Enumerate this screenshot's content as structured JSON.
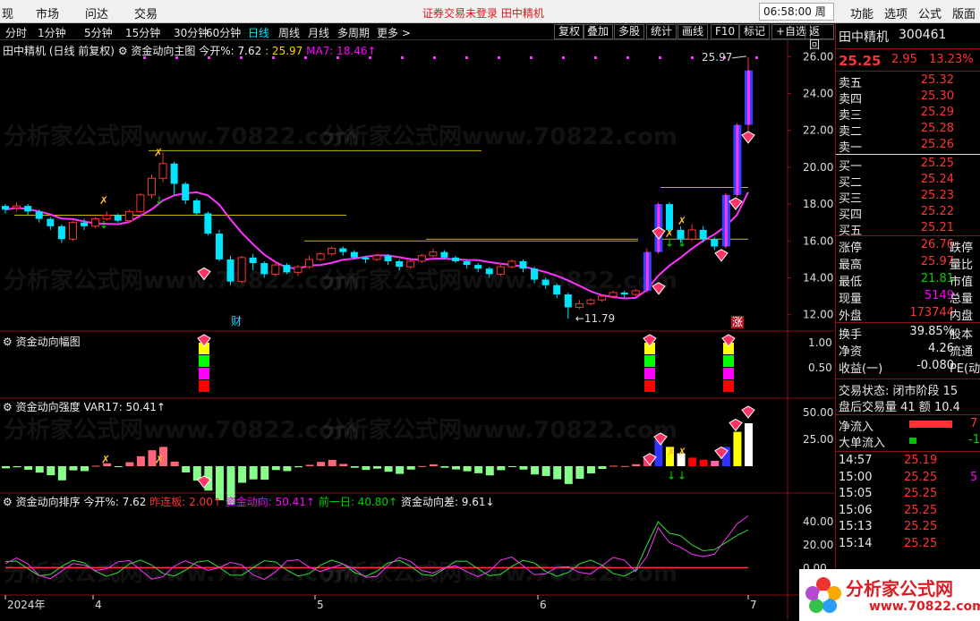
{
  "menu": {
    "items": [
      "现",
      "市场",
      "问达",
      "交易"
    ],
    "warning": "证券交易未登录  田中精机",
    "clock": "06:58:00 周二",
    "right_items": [
      "功能",
      "选项",
      "公式",
      "版面"
    ]
  },
  "toolbar": {
    "periods": [
      "分时",
      "1分钟",
      "5分钟",
      "15分钟",
      "30分钟",
      "60分钟",
      "日线",
      "周线",
      "月线",
      "多周期",
      "更多 >"
    ],
    "active_period": "日线",
    "buttons": [
      "复权",
      "叠加",
      "多股",
      "统计",
      "画线",
      "F10",
      "标记",
      "+自选",
      "返回"
    ]
  },
  "main_panel": {
    "title": "田中精机 (日线 前复权)",
    "indicator": "资金动向主图",
    "open_pct": "今开%: 7.62",
    "value1": ": 25.97",
    "ma_label": "MA7: 18.46↑",
    "high_label": "25.97",
    "low_label": "11.79",
    "tag_cai": "财",
    "tag_zhang": "涨",
    "y_ticks": [
      "26.00",
      "24.00",
      "22.00",
      "20.00",
      "18.00",
      "16.00",
      "14.00",
      "12.00"
    ]
  },
  "panel2": {
    "title": "资金动向幅图",
    "y_ticks": [
      "1.00",
      "0.50"
    ]
  },
  "panel3": {
    "title": "资金动向强度",
    "var": "VAR17: 50.41↑",
    "y_ticks": [
      "50.00",
      "25.00"
    ]
  },
  "panel4": {
    "title": "资金动向排序",
    "open_pct": "今开%: 7.62",
    "prev_limit": "昨连板: 2.00↑",
    "flow": "资金动向: 50.41↑",
    "prev_day": "前一日: 40.80↑",
    "diff": "资金动向差: 9.61↓",
    "y_ticks": [
      "40.00",
      "20.00",
      "0.00"
    ]
  },
  "x_axis": [
    "2024年",
    "4",
    "5",
    "6",
    "7"
  ],
  "watermark": "分析家公式网www.70822.com",
  "quote": {
    "name": "田中精机",
    "code": "300461",
    "price": "25.25",
    "change": "2.95",
    "change_pct": "13.23%",
    "asks": [
      {
        "label": "卖五",
        "price": "25.32"
      },
      {
        "label": "卖四",
        "price": "25.30"
      },
      {
        "label": "卖三",
        "price": "25.29"
      },
      {
        "label": "卖二",
        "price": "25.28"
      },
      {
        "label": "卖一",
        "price": "25.26"
      }
    ],
    "bids": [
      {
        "label": "买一",
        "price": "25.25"
      },
      {
        "label": "买二",
        "price": "25.24"
      },
      {
        "label": "买三",
        "price": "25.23"
      },
      {
        "label": "买四",
        "price": "25.22"
      },
      {
        "label": "买五",
        "price": "25.21"
      }
    ],
    "stats": [
      {
        "label": "涨停",
        "value": "26.76",
        "color": "#ff3333",
        "right": "跌停"
      },
      {
        "label": "最高",
        "value": "25.97",
        "color": "#ff3333",
        "right": "量比"
      },
      {
        "label": "最低",
        "value": "21.81",
        "color": "#00d000",
        "right": "市值"
      },
      {
        "label": "现量",
        "value": "5149",
        "color": "#ff00ff",
        "right": "总量"
      },
      {
        "label": "外盘",
        "value": "173744",
        "color": "#ff3333",
        "right": "内盘"
      }
    ],
    "stats2": [
      {
        "label": "换手",
        "value": "39.85%",
        "color": "#eeeeee",
        "right": "股本"
      },
      {
        "label": "净资",
        "value": "4.26",
        "color": "#eeeeee",
        "right": "流通"
      },
      {
        "label": "收益(一)",
        "value": "-0.080",
        "color": "#eeeeee",
        "right": "PE(动"
      }
    ],
    "trade_status": "交易状态: 闭市阶段 15",
    "after_hours": "盘后交易量 41 额 10.4",
    "net_inflow": "净流入",
    "big_inflow": "大单流入",
    "net_inflow_right": "7",
    "big_inflow_right": "-1",
    "ticks": [
      {
        "time": "14:57",
        "price": "25.19"
      },
      {
        "time": "15:00",
        "price": "25.25",
        "right": "5"
      },
      {
        "time": "15:05",
        "price": "25.25"
      },
      {
        "time": "15:06",
        "price": "25.25"
      },
      {
        "time": "15:13",
        "price": "25.25"
      },
      {
        "time": "15:14",
        "price": "25.25"
      }
    ]
  },
  "logo": {
    "title": "分析家公式网",
    "url": "www.70822.com"
  },
  "colors": {
    "up": "#ff3333",
    "down": "#00e5ff",
    "ma": "#ff33ff",
    "bg": "#000000",
    "grid": "#8a1111"
  },
  "chart_data": {
    "type": "candlestick",
    "x": [
      "2024-03",
      "2024-04",
      "2024-05",
      "2024-06",
      "2024-07"
    ],
    "ylim": [
      11.5,
      26.5
    ],
    "candles": [
      [
        17.9,
        17.7,
        18.0,
        17.5
      ],
      [
        17.8,
        17.9,
        18.1,
        17.6
      ],
      [
        17.9,
        17.6,
        18.0,
        17.4
      ],
      [
        17.6,
        17.2,
        17.7,
        17.0
      ],
      [
        17.2,
        16.8,
        17.3,
        16.6
      ],
      [
        16.8,
        16.1,
        16.9,
        15.9
      ],
      [
        16.1,
        17.0,
        17.1,
        16.0
      ],
      [
        17.0,
        16.8,
        17.2,
        16.6
      ],
      [
        16.8,
        17.2,
        17.3,
        16.7
      ],
      [
        17.2,
        17.4,
        17.6,
        17.1
      ],
      [
        17.4,
        17.1,
        17.5,
        17.0
      ],
      [
        17.1,
        17.6,
        17.7,
        17.0
      ],
      [
        17.6,
        18.5,
        18.6,
        17.5
      ],
      [
        18.5,
        19.4,
        19.6,
        18.3
      ],
      [
        19.4,
        20.2,
        20.8,
        19.2
      ],
      [
        20.2,
        19.1,
        20.3,
        18.5
      ],
      [
        19.1,
        18.2,
        19.2,
        18.0
      ],
      [
        18.2,
        17.5,
        18.3,
        17.4
      ],
      [
        17.5,
        16.4,
        17.6,
        16.3
      ],
      [
        16.4,
        15.0,
        16.6,
        14.9
      ],
      [
        15.0,
        13.8,
        15.2,
        13.6
      ],
      [
        13.8,
        15.1,
        15.2,
        13.7
      ],
      [
        15.1,
        14.8,
        15.3,
        14.4
      ],
      [
        14.8,
        14.2,
        14.9,
        14.0
      ],
      [
        14.2,
        14.7,
        14.9,
        14.1
      ],
      [
        14.7,
        14.3,
        14.8,
        14.2
      ],
      [
        14.3,
        14.6,
        14.7,
        14.1
      ],
      [
        14.6,
        15.0,
        15.2,
        14.5
      ],
      [
        15.0,
        15.3,
        15.4,
        14.9
      ],
      [
        15.3,
        15.6,
        15.7,
        15.2
      ],
      [
        15.6,
        15.4,
        15.7,
        15.2
      ],
      [
        15.4,
        15.1,
        15.5,
        15.0
      ],
      [
        15.1,
        15.0,
        15.2,
        14.8
      ],
      [
        15.0,
        15.2,
        15.3,
        14.9
      ],
      [
        15.2,
        14.9,
        15.3,
        14.7
      ],
      [
        14.9,
        14.6,
        15.0,
        14.4
      ],
      [
        14.6,
        14.9,
        15.0,
        14.5
      ],
      [
        14.9,
        15.2,
        15.3,
        14.8
      ],
      [
        15.2,
        15.4,
        15.6,
        15.1
      ],
      [
        15.4,
        15.1,
        15.5,
        15.0
      ],
      [
        15.1,
        14.9,
        15.2,
        14.8
      ],
      [
        14.9,
        14.7,
        15.0,
        14.5
      ],
      [
        14.7,
        14.5,
        14.8,
        14.3
      ],
      [
        14.5,
        14.2,
        14.6,
        14.0
      ],
      [
        14.2,
        14.6,
        14.8,
        14.1
      ],
      [
        14.6,
        14.9,
        15.0,
        14.5
      ],
      [
        14.9,
        14.5,
        15.0,
        14.3
      ],
      [
        14.5,
        13.9,
        14.6,
        13.7
      ],
      [
        13.9,
        13.6,
        14.0,
        13.4
      ],
      [
        13.6,
        13.1,
        13.7,
        12.9
      ],
      [
        13.1,
        12.4,
        13.2,
        11.79
      ],
      [
        12.4,
        12.6,
        12.8,
        12.3
      ],
      [
        12.6,
        12.8,
        12.9,
        12.5
      ],
      [
        12.8,
        13.0,
        13.1,
        12.7
      ],
      [
        13.0,
        13.2,
        13.3,
        12.9
      ],
      [
        13.2,
        13.1,
        13.3,
        12.9
      ],
      [
        13.1,
        13.3,
        13.4,
        13.0
      ],
      [
        13.3,
        15.4,
        15.6,
        13.2
      ],
      [
        15.4,
        18.0,
        18.1,
        15.3
      ],
      [
        18.0,
        16.6,
        18.1,
        16.4
      ],
      [
        16.6,
        16.1,
        16.8,
        15.9
      ],
      [
        16.1,
        16.6,
        16.9,
        16.0
      ],
      [
        16.6,
        16.1,
        16.8,
        15.9
      ],
      [
        16.1,
        15.7,
        16.2,
        15.5
      ],
      [
        15.7,
        18.5,
        18.6,
        15.6
      ],
      [
        18.5,
        22.3,
        22.4,
        18.4
      ],
      [
        22.3,
        25.25,
        25.97,
        21.81
      ]
    ]
  }
}
